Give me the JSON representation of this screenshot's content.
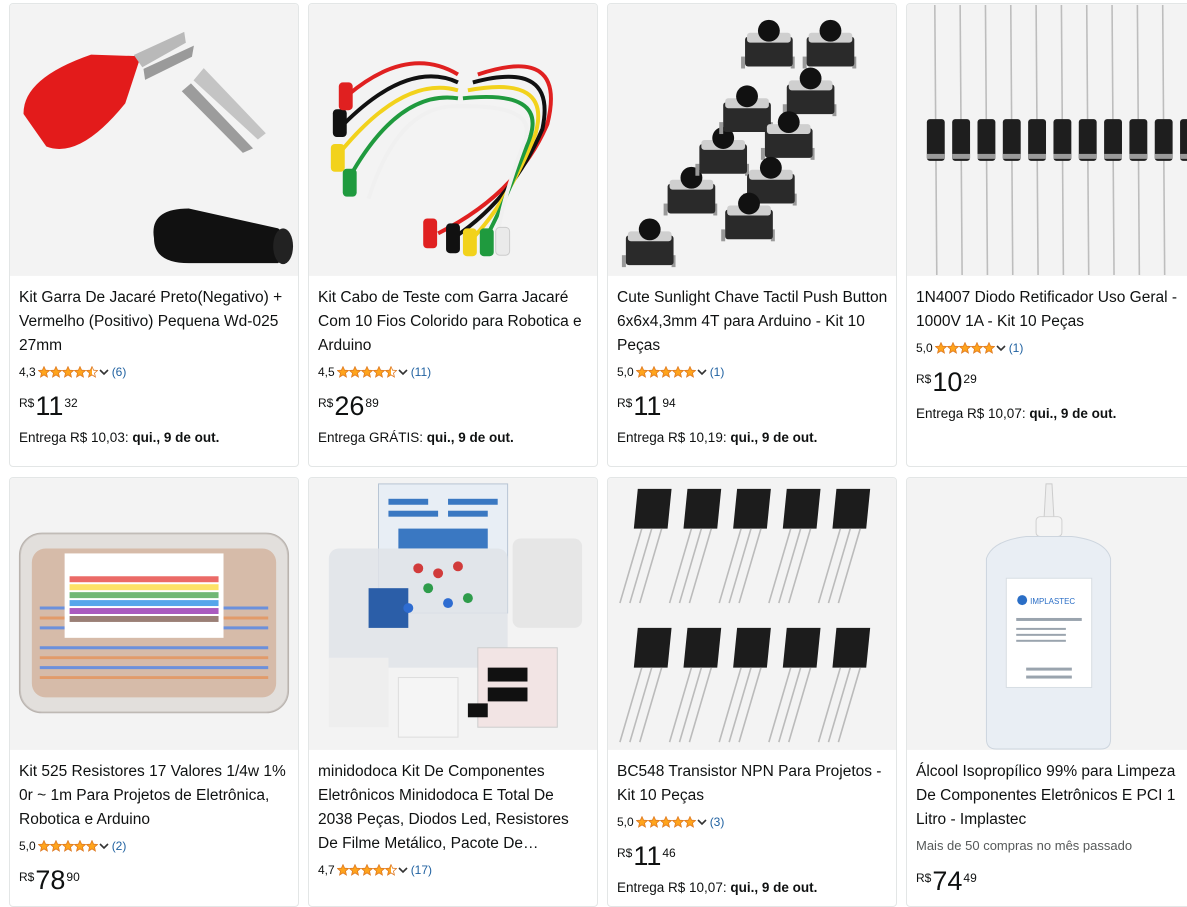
{
  "products": [
    {
      "title": "Kit Garra De Jacaré Preto(Negativo) + Vermelho (Positivo) Pequena Wd-025 27mm",
      "rating": "4,3",
      "stars": 4.5,
      "reviews": "(6)",
      "currency": "R$",
      "price_whole": "11",
      "price_fraction": "32",
      "delivery_prefix": "Entrega R$ 10,03: ",
      "delivery_date": "qui., 9 de out.",
      "image_icon": "alligator-clips-icon"
    },
    {
      "title": "Kit Cabo de Teste com Garra Jacaré Com 10 Fios Colorido para Robotica e Arduino",
      "rating": "4,5",
      "stars": 4.5,
      "reviews": "(11)",
      "currency": "R$",
      "price_whole": "26",
      "price_fraction": "89",
      "delivery_prefix": "Entrega GRÁTIS: ",
      "delivery_date": "qui., 9 de out.",
      "image_icon": "test-leads-icon"
    },
    {
      "title": "Cute Sunlight Chave Tactil Push Button 6x6x4,3mm 4T para Arduino - Kit 10 Peças",
      "rating": "5,0",
      "stars": 5,
      "reviews": "(1)",
      "currency": "R$",
      "price_whole": "11",
      "price_fraction": "94",
      "delivery_prefix": "Entrega R$ 10,19: ",
      "delivery_date": "qui., 9 de out.",
      "image_icon": "push-buttons-icon"
    },
    {
      "title": "1N4007 Diodo Retificador Uso Geral - 1000V 1A - Kit 10 Peças",
      "rating": "5,0",
      "stars": 5,
      "reviews": "(1)",
      "currency": "R$",
      "price_whole": "10",
      "price_fraction": "29",
      "delivery_prefix": "Entrega R$ 10,07: ",
      "delivery_date": "qui., 9 de out.",
      "image_icon": "diodes-icon"
    },
    {
      "title": "Kit 525 Resistores 17 Valores 1/4w 1% 0r ~ 1m Para Projetos de Eletrônica, Robotica e Arduino",
      "rating": "5,0",
      "stars": 5,
      "reviews": "(2)",
      "currency": "R$",
      "price_whole": "78",
      "price_fraction": "90",
      "image_icon": "resistor-box-icon"
    },
    {
      "title": "minidodoca Kit De Componentes Eletrônicos Minidodoca E Total De 2038 Peças, Diodos Led, Resistores De Filme Metálico, Pacote De…",
      "rating": "4,7",
      "stars": 4.5,
      "reviews": "(17)",
      "image_icon": "component-kit-icon"
    },
    {
      "title": "BC548 Transistor NPN Para Projetos - Kit 10 Peças",
      "rating": "5,0",
      "stars": 5,
      "reviews": "(3)",
      "currency": "R$",
      "price_whole": "11",
      "price_fraction": "46",
      "delivery_prefix": "Entrega R$ 10,07: ",
      "delivery_date": "qui., 9 de out.",
      "image_icon": "transistors-icon"
    },
    {
      "title": "Álcool Isopropílico 99% para Limpeza De Componentes Eletrônicos E PCI 1 Litro - Implastec",
      "note": "Mais de 50 compras no mês passado",
      "currency": "R$",
      "price_whole": "74",
      "price_fraction": "49",
      "image_icon": "alcohol-bottle-icon",
      "bottle_label": "IMPLASTEC"
    }
  ],
  "colors": {
    "star": "#ffa41c",
    "link": "#2162a1",
    "border": "#e3e6e6"
  }
}
